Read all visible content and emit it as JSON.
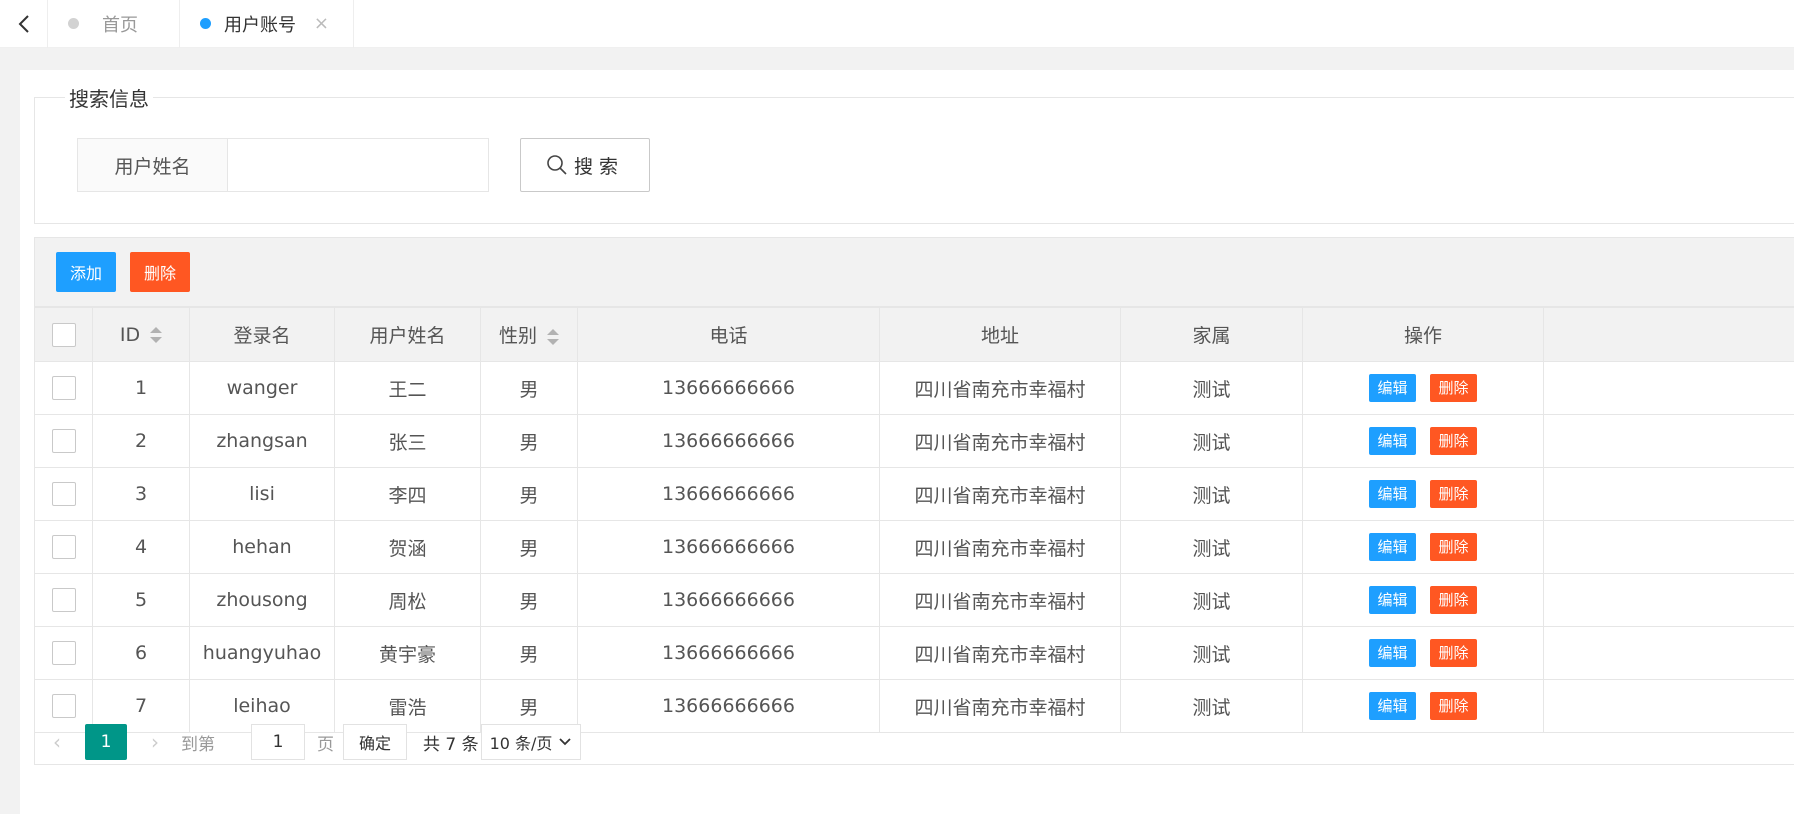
{
  "tabs": [
    {
      "label": "首页",
      "active": false
    },
    {
      "label": "用户账号",
      "active": true,
      "closable": true
    }
  ],
  "search": {
    "legend": "搜索信息",
    "label": "用户姓名",
    "value": "",
    "button_label": "搜索"
  },
  "toolbar": {
    "add_label": "添加",
    "delete_label": "删除"
  },
  "table": {
    "columns": [
      "ID",
      "登录名",
      "用户姓名",
      "性别",
      "电话",
      "地址",
      "家属",
      "操作"
    ],
    "edit_label": "编辑",
    "delete_label": "删除",
    "rows": [
      {
        "id": "1",
        "login": "wanger",
        "name": "王二",
        "gender": "男",
        "phone": "13666666666",
        "address": "四川省南充市幸福村",
        "family": "测试"
      },
      {
        "id": "2",
        "login": "zhangsan",
        "name": "张三",
        "gender": "男",
        "phone": "13666666666",
        "address": "四川省南充市幸福村",
        "family": "测试"
      },
      {
        "id": "3",
        "login": "lisi",
        "name": "李四",
        "gender": "男",
        "phone": "13666666666",
        "address": "四川省南充市幸福村",
        "family": "测试"
      },
      {
        "id": "4",
        "login": "hehan",
        "name": "贺涵",
        "gender": "男",
        "phone": "13666666666",
        "address": "四川省南充市幸福村",
        "family": "测试"
      },
      {
        "id": "5",
        "login": "zhousong",
        "name": "周松",
        "gender": "男",
        "phone": "13666666666",
        "address": "四川省南充市幸福村",
        "family": "测试"
      },
      {
        "id": "6",
        "login": "huangyuhao",
        "name": "黄宇豪",
        "gender": "男",
        "phone": "13666666666",
        "address": "四川省南充市幸福村",
        "family": "测试"
      },
      {
        "id": "7",
        "login": "leihao",
        "name": "雷浩",
        "gender": "男",
        "phone": "13666666666",
        "address": "四川省南充市幸福村",
        "family": "测试"
      }
    ]
  },
  "pager": {
    "current_page": "1",
    "goto_label": "到第",
    "goto_value": "1",
    "page_label": "页",
    "confirm_label": "确定",
    "total_label": "共 7 条",
    "page_size_label": "10 条/页"
  },
  "colors": {
    "primary": "#1e9fff",
    "danger": "#ff5722",
    "pager_active": "#009688"
  }
}
